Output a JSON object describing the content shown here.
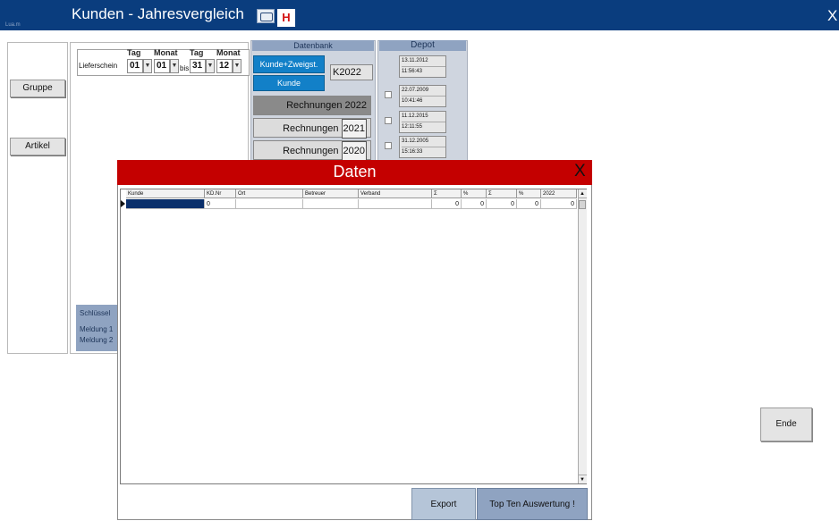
{
  "window": {
    "tiny_label": "Lua.m",
    "title": "Kunden - Jahresvergleich",
    "help_label": "H",
    "close_glyph": "X"
  },
  "left_panel": {
    "gruppe": "Gruppe",
    "artikel": "Artikel"
  },
  "date_filter": {
    "label": "Lieferschein",
    "headers": [
      "Tag",
      "Monat",
      "Tag",
      "Monat"
    ],
    "from_day": "01",
    "from_month": "01",
    "to_word": "bis",
    "to_day": "31",
    "to_month": "12"
  },
  "bottom_box": {
    "schluessel": "Schlüssel",
    "meldung1": "Meldung 1",
    "meldung2": "Meldung 2"
  },
  "datenbank": {
    "title": "Datenbank",
    "kunde_zweigst": "Kunde+Zweigst.",
    "kunde": "Kunde",
    "k_prefix": "K",
    "k_year": "2022",
    "rechnungen": [
      {
        "label": "Rechnungen",
        "year": "2022"
      },
      {
        "label": "Rechnungen",
        "year": "2021"
      },
      {
        "label": "Rechnungen",
        "year": "2020"
      }
    ]
  },
  "depot": {
    "title": "Depot",
    "entries": [
      {
        "date": "13.11.2012",
        "time": "11:56:43"
      },
      {
        "date": "22.07.2009",
        "time": "10:41:46"
      },
      {
        "date": "11.12.2015",
        "time": "12:11:55"
      },
      {
        "date": "31.12.2005",
        "time": "15:16:33"
      }
    ]
  },
  "dialog": {
    "title": "Daten",
    "close_glyph": "X",
    "columns": [
      "Kunde",
      "KD.Nr",
      "Ort",
      "Betreuer",
      "Verband",
      "Σ",
      "%",
      "Σ",
      "%",
      "2022"
    ],
    "row": [
      "",
      "0",
      "",
      "",
      "",
      "0",
      "0",
      "0",
      "0",
      "0"
    ],
    "export": "Export",
    "top_ten": "Top Ten Auswertung !"
  },
  "ende": "Ende"
}
